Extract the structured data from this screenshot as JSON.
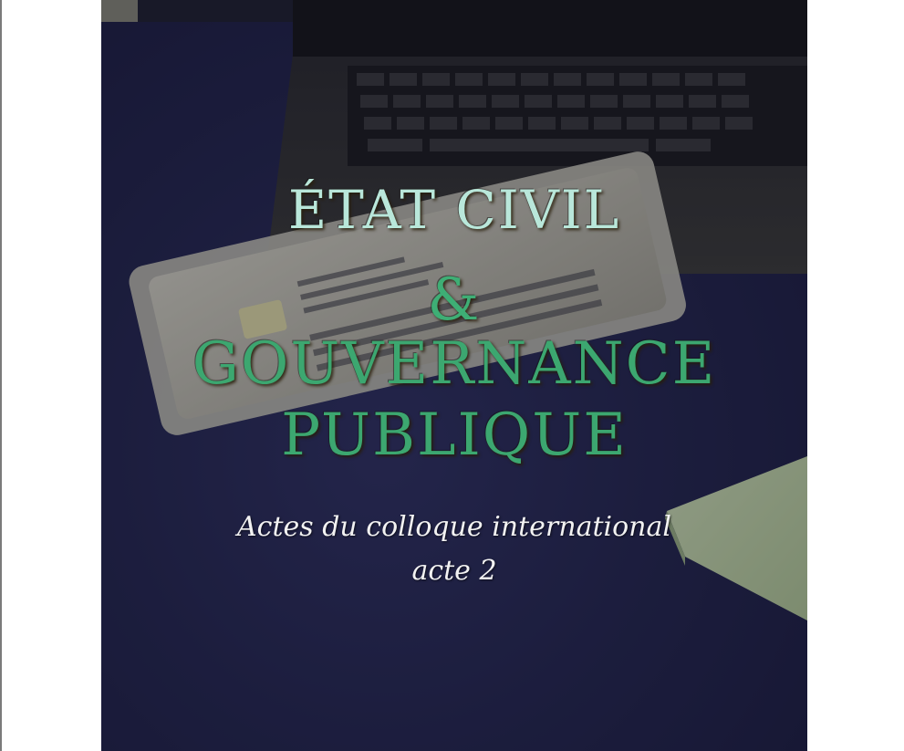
{
  "cover": {
    "title_line1": "ÉTAT CIVIL",
    "title_line2": "&",
    "title_line3": "GOUVERNANCE",
    "title_line4": "PUBLIQUE",
    "subtitle_line1": "Actes du colloque international",
    "subtitle_line2": "acte 2"
  },
  "colors": {
    "tablecloth": "#24264d",
    "title_light": "#b9e7da",
    "title_green": "#3ca770",
    "subtitle": "#f2f2f2"
  }
}
